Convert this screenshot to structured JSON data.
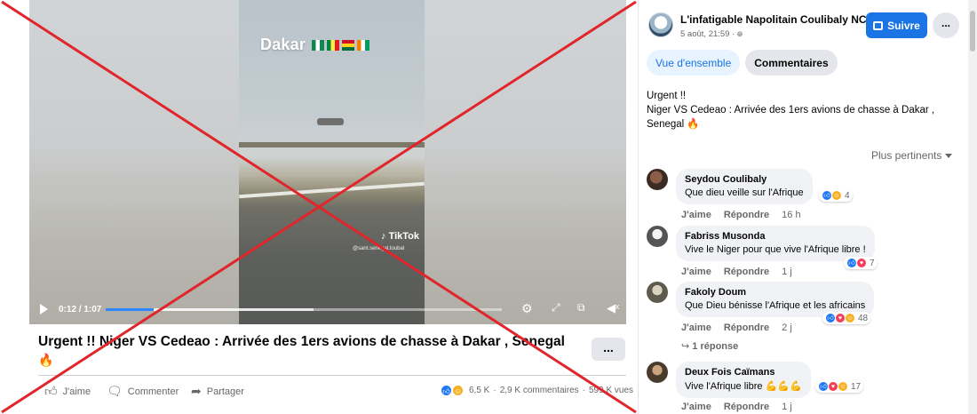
{
  "video": {
    "overlay_title": "Dakar",
    "tiktok_label": "TikTok",
    "tiktok_handle": "@sant.senegal.toubal",
    "current_time": "0:12 / 1:07",
    "progress_fraction": 0.122
  },
  "post": {
    "title": "Urgent !! Niger VS Cedeao : Arrivée des 1ers avions de chasse à Dakar , Senegal",
    "more_label": "...",
    "actions": {
      "like": "J'aime",
      "comment": "Commenter",
      "share": "Partager"
    },
    "stats": {
      "reactions": "6,5 K",
      "comments": "2,9 K commentaires",
      "views": "599 K vues"
    }
  },
  "page": {
    "name": "L'infatigable Napolitain Coulibaly NC",
    "timestamp": "5 août, 21:59",
    "follow_label": "Suivre",
    "more_label": "..."
  },
  "tabs": [
    {
      "label": "Vue d'ensemble",
      "active": true
    },
    {
      "label": "Commentaires",
      "active": false
    }
  ],
  "caption": {
    "line1": "Urgent !!",
    "line2": "Niger VS Cedeao : Arrivée des 1ers avions de chasse à Dakar ,",
    "line3": "Senegal"
  },
  "sort_label": "Plus pertinents",
  "comments": [
    {
      "author": "Seydou Coulibaly",
      "text": "Que dieu veille sur l'Afrique",
      "reactions": "4",
      "like": "J'aime",
      "reply": "Répondre",
      "time": "16 h"
    },
    {
      "author": "Fabriss Musonda",
      "text": "Vive le Niger pour que vive l'Afrique libre !",
      "reactions": "7",
      "like": "J'aime",
      "reply": "Répondre",
      "time": "1 j"
    },
    {
      "author": "Fakoly Doum",
      "text": "Que Dieu bénisse l'Afrique et les africains",
      "reactions": "48",
      "like": "J'aime",
      "reply": "Répondre",
      "time": "2 j",
      "replies": "1 réponse"
    },
    {
      "author": "Deux Fois Caïmans",
      "text": "Vive l'Afrique libre",
      "reactions": "17",
      "like": "J'aime",
      "reply": "Répondre",
      "time": "1 j"
    }
  ],
  "colors": {
    "accent": "#1b74e4",
    "cross": "#e0262b"
  }
}
